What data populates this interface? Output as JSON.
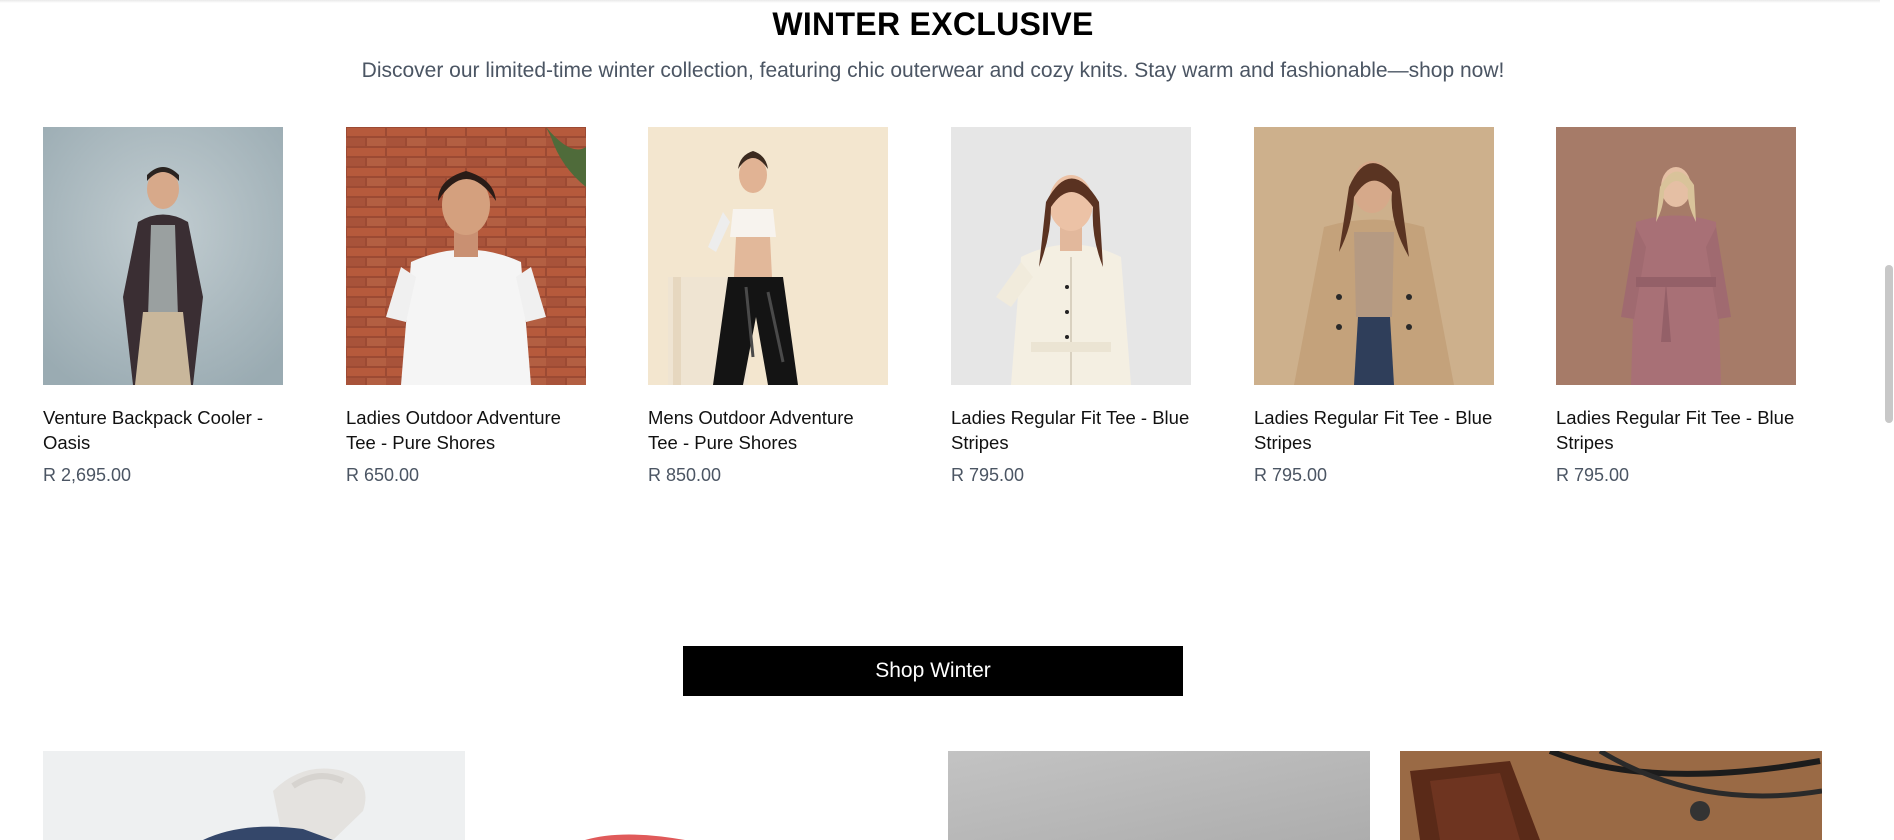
{
  "section": {
    "title": "WINTER EXCLUSIVE",
    "subtitle": "Discover our limited-time winter collection, featuring chic outerwear and cozy knits. Stay warm and fashionable—shop now!"
  },
  "products": [
    {
      "name": "Venture Backpack Cooler - Oasis",
      "price": "R 2,695.00"
    },
    {
      "name": "Ladies Outdoor Adventure Tee - Pure Shores",
      "price": "R 650.00"
    },
    {
      "name": "Mens Outdoor Adventure Tee - Pure Shores",
      "price": "R 850.00"
    },
    {
      "name": "Ladies Regular Fit Tee - Blue Stripes",
      "price": "R 795.00"
    },
    {
      "name": "Ladies Regular Fit Tee - Blue Stripes",
      "price": "R 795.00"
    },
    {
      "name": "Ladies Regular Fit Tee - Blue Stripes",
      "price": "R 795.00"
    }
  ],
  "cta": {
    "label": "Shop Winter"
  },
  "colors": {
    "button_bg": "#000000",
    "button_text": "#ffffff",
    "price_text": "#4b5563"
  }
}
